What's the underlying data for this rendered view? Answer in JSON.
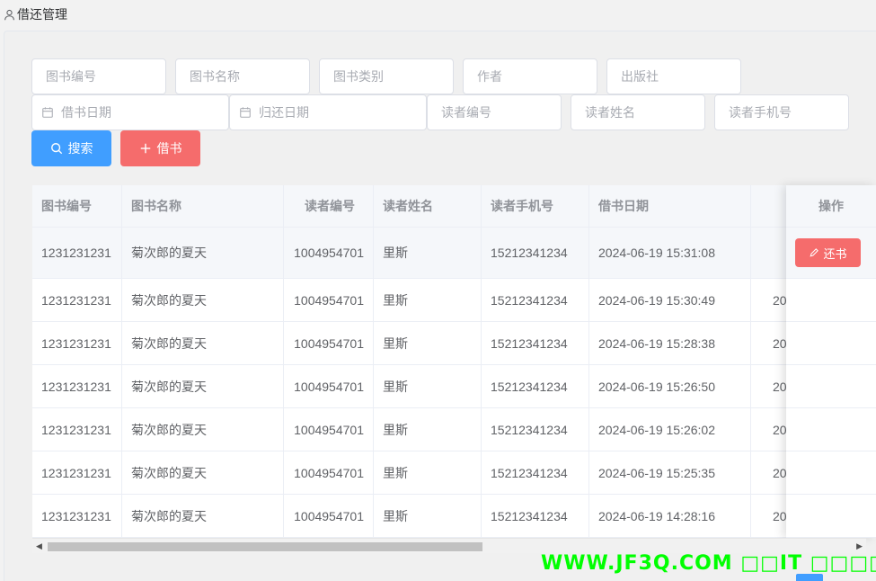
{
  "page": {
    "title": "借还管理"
  },
  "filters": {
    "book_id": "图书编号",
    "book_name": "图书名称",
    "book_category": "图书类别",
    "author": "作者",
    "publisher": "出版社",
    "borrow_date": "借书日期",
    "return_date": "归还日期",
    "reader_id": "读者编号",
    "reader_name": "读者姓名",
    "reader_phone": "读者手机号"
  },
  "buttons": {
    "search": "搜索",
    "borrow": "借书",
    "return": "还书"
  },
  "table": {
    "columns": [
      "图书编号",
      "图书名称",
      "读者编号",
      "读者姓名",
      "读者手机号",
      "借书日期",
      ""
    ],
    "action_column": "操作",
    "rows": [
      [
        "1231231231",
        "菊次郎的夏天",
        "1004954701",
        "里斯",
        "15212341234",
        "2024-06-19 15:31:08",
        ""
      ],
      [
        "1231231231",
        "菊次郎的夏天",
        "1004954701",
        "里斯",
        "15212341234",
        "2024-06-19 15:30:49",
        "20"
      ],
      [
        "1231231231",
        "菊次郎的夏天",
        "1004954701",
        "里斯",
        "15212341234",
        "2024-06-19 15:28:38",
        "20"
      ],
      [
        "1231231231",
        "菊次郎的夏天",
        "1004954701",
        "里斯",
        "15212341234",
        "2024-06-19 15:26:50",
        "20"
      ],
      [
        "1231231231",
        "菊次郎的夏天",
        "1004954701",
        "里斯",
        "15212341234",
        "2024-06-19 15:26:02",
        "20"
      ],
      [
        "1231231231",
        "菊次郎的夏天",
        "1004954701",
        "里斯",
        "15212341234",
        "2024-06-19 15:25:35",
        "20"
      ],
      [
        "1231231231",
        "菊次郎的夏天",
        "1004954701",
        "里斯",
        "15212341234",
        "2024-06-19 14:28:16",
        "20"
      ]
    ]
  },
  "watermark": "WWW.JF3Q.COM □□IT □□□□",
  "colors": {
    "primary": "#409eff",
    "danger": "#f56c6c",
    "watermark": "#00ff00"
  },
  "icons": {
    "header": "user-icon",
    "date": "calendar-icon",
    "search": "search-icon",
    "borrow": "plus-icon",
    "return": "edit-icon"
  }
}
